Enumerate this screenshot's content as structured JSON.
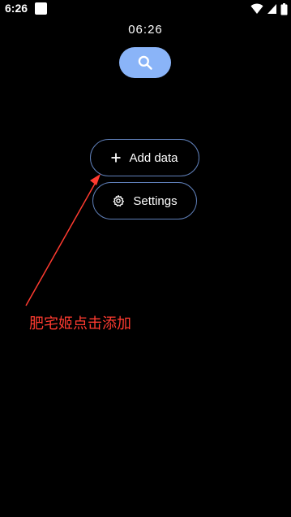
{
  "status_bar": {
    "time": "6:26",
    "icons": [
      "notification-square-icon",
      "wifi-icon",
      "cellular-signal-icon",
      "battery-icon"
    ]
  },
  "clock": {
    "time": "06:26"
  },
  "search": {
    "icon": "search-icon"
  },
  "actions": {
    "add_data": {
      "icon": "plus-icon",
      "label": "Add data"
    },
    "settings": {
      "icon": "gear-icon",
      "label": "Settings"
    }
  },
  "annotation": {
    "text": "肥宅姬点击添加",
    "color": "#ff3b30"
  },
  "colors": {
    "background": "#000000",
    "accent": "#8ab4f8",
    "button_border": "#5f7fb8"
  }
}
